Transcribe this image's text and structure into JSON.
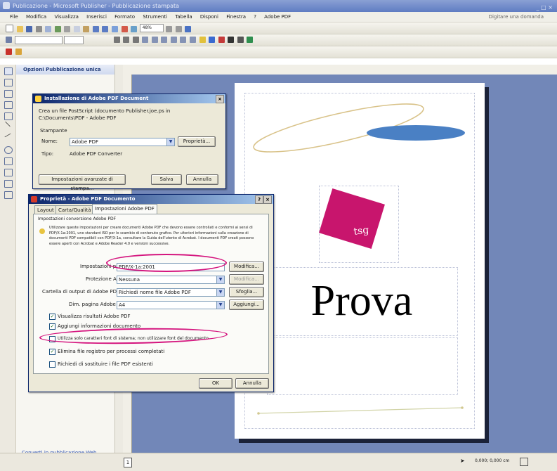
{
  "app": {
    "title": "Publicazione - Microsoft Publisher - Pubblicazione stampata",
    "window_controls": "_ □ ×"
  },
  "menu": {
    "items": [
      "File",
      "Modifica",
      "Visualizza",
      "Inserisci",
      "Formato",
      "Strumenti",
      "Tabella",
      "Disponi",
      "Finestra",
      "?",
      "Adobe PDF"
    ],
    "help_placeholder": "Digitare una domanda"
  },
  "toolbar": {
    "zoom": "48%"
  },
  "task_pane": {
    "title": "Opzioni Pubblicazione unica",
    "link": "Converti in pubblicazione Web..."
  },
  "print_dialog": {
    "title": "Installazione di Adobe PDF Document",
    "info_line1": "Crea un file PostScript (documento Publisher.joe.ps in",
    "info_line2": "C:\\Documents\\PDF - Adobe PDF",
    "group_label": "Stampante",
    "name_label": "Nome:",
    "name_value": "Adobe PDF",
    "properties_button": "Proprietà...",
    "type_label": "Tipo:",
    "type_value": "Adobe PDF Converter",
    "advanced_button": "Impostazioni avanzate di stampa...",
    "save_button": "Salva",
    "cancel_button": "Annulla"
  },
  "properties_dialog": {
    "title": "Proprietà - Adobe PDF Documento",
    "help_glyph": "?",
    "close_glyph": "×",
    "tabs": [
      "Layout",
      "Carta/Qualità",
      "Impostazioni Adobe PDF"
    ],
    "section_title": "Impostazioni conversione Adobe PDF",
    "description": "Utilizzare queste impostazioni per creare documenti Adobe PDF che devono essere controllati e conformi ai sensi di PDF/X-1a:2001, uno standard ISO per lo scambio di contenuto grafico. Per ulteriori informazioni sulla creazione di documenti PDF compatibili con PDF/X-1a, consultare la Guida dell'utente di Acrobat. I documenti PDF creati possono essere aperti con Acrobat e Adobe Reader 4.0 e versioni successive.",
    "rows": [
      {
        "label": "Impostazioni predefinite:",
        "value": "PDF/X-1a:2001",
        "button": "Modifica..."
      },
      {
        "label": "Protezione Adobe PDF:",
        "value": "Nessuna",
        "button": "Modifica..."
      },
      {
        "label": "Cartella di output di Adobe PDF:",
        "value": "Richiedi nome file Adobe PDF",
        "button": "Sfoglia..."
      },
      {
        "label": "Dim. pagina Adobe PDF:",
        "value": "A4",
        "button": "Aggiungi..."
      }
    ],
    "checkboxes": [
      {
        "label": "Visualizza risultati Adobe PDF",
        "checked": true
      },
      {
        "label": "Aggiungi informazioni documento",
        "checked": true
      },
      {
        "label": "Utilizza solo caratteri font di sistema; non utilizzare font del documento",
        "checked": false
      },
      {
        "label": "Elimina file registro per processi completati",
        "checked": true
      },
      {
        "label": "Richiedi di sostituire i file PDF esistenti",
        "checked": false
      }
    ],
    "ok_button": "OK",
    "cancel_button": "Annulla"
  },
  "document": {
    "heading": "Prova",
    "logo_text": "tsg"
  },
  "status_bar": {
    "coords": "0,000; 0,000 cm",
    "page_number": "1"
  },
  "colors": {
    "workspace": "#7287b8",
    "logo_magenta": "#c8156d",
    "highlight_oval": "#d4147e",
    "ellipse_blue": "#4a80c4"
  }
}
